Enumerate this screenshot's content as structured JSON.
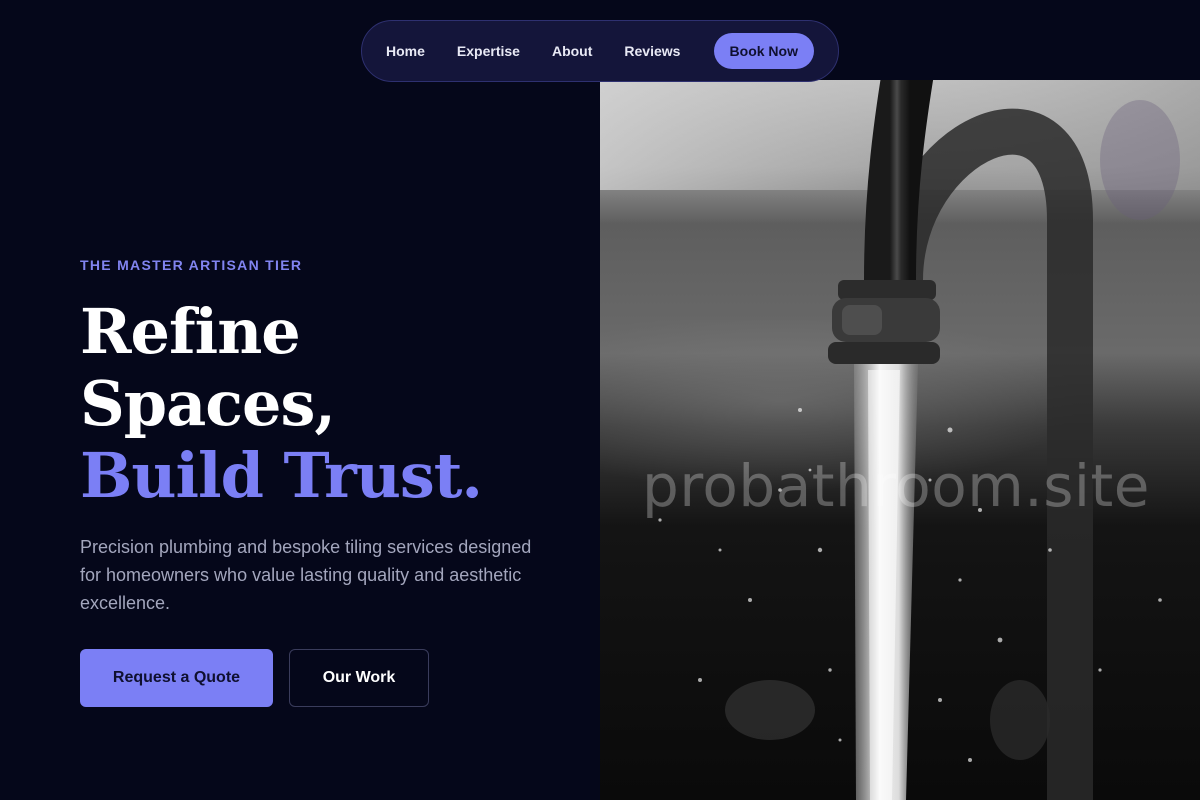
{
  "nav": {
    "links": [
      "Home",
      "Expertise",
      "About",
      "Reviews"
    ],
    "cta": "Book Now"
  },
  "hero": {
    "eyebrow": "THE MASTER ARTISAN TIER",
    "headline_line1": "Refine",
    "headline_line2": "Spaces,",
    "headline_accent": "Build Trust.",
    "description": "Precision plumbing and bespoke tiling services designed for homeowners who value lasting quality and aesthetic excellence.",
    "primary_button": "Request a Quote",
    "secondary_button": "Our Work"
  },
  "image": {
    "watermark": "probathroom.site"
  },
  "colors": {
    "background": "#05071a",
    "accent": "#7b7ff5",
    "nav_background": "#14153a",
    "text_muted": "#a3a6bd"
  }
}
